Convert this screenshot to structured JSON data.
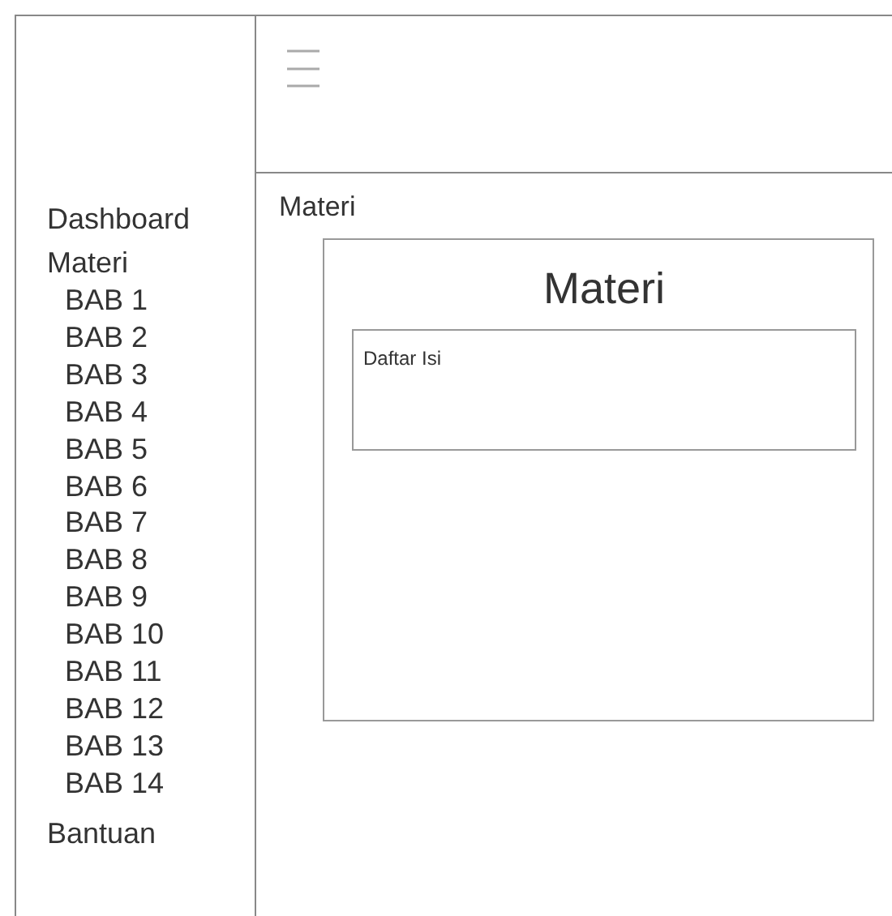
{
  "sidebar": {
    "items": [
      {
        "label": "Dashboard"
      },
      {
        "label": "Materi",
        "children": [
          {
            "label": "BAB 1"
          },
          {
            "label": "BAB 2"
          },
          {
            "label": "BAB 3"
          },
          {
            "label": "BAB 4"
          },
          {
            "label": "BAB 5"
          },
          {
            "label": "BAB 6"
          },
          {
            "label": "BAB 7"
          },
          {
            "label": "BAB 8"
          },
          {
            "label": "BAB 9"
          },
          {
            "label": "BAB 10"
          },
          {
            "label": "BAB 11"
          },
          {
            "label": "BAB 12"
          },
          {
            "label": "BAB 13"
          },
          {
            "label": "BAB 14"
          }
        ]
      },
      {
        "label": "Bantuan"
      }
    ]
  },
  "breadcrumb": "Materi",
  "card": {
    "title": "Materi",
    "contents_box": {
      "label": "Daftar Isi"
    }
  }
}
